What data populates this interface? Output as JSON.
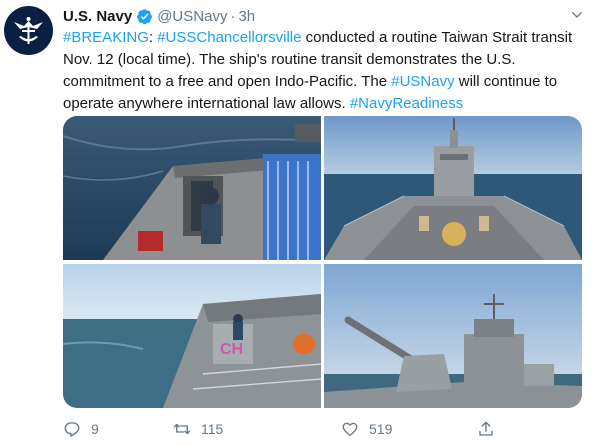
{
  "account": {
    "name": "U.S. Navy",
    "handle": "@USNavy",
    "separator": "·",
    "time": "3h"
  },
  "tweet": {
    "hashtag_breaking": "#BREAKING",
    "colon": ":",
    "mention": "#USSChancellorsville",
    "text_1": " conducted a routine Taiwan Strait transit Nov. 12 (local time). The ship's routine transit demonstrates the U.S. commitment to a free and open Indo-Pacific. The ",
    "hashtag_usnavy": "#USNavy",
    "text_2": " will continue to operate anywhere international law allows. ",
    "hashtag_readiness": "#NavyReadiness"
  },
  "actions": {
    "replies": "9",
    "retweets": "115",
    "likes": "519"
  },
  "colors": {
    "link": "#1da1f2",
    "muted": "#657786",
    "verified": "#1da1f2",
    "text": "#14171a"
  },
  "icons": {
    "avatar": "navy-emblem-icon",
    "verified": "verified-badge-icon",
    "menu": "chevron-down-icon",
    "reply": "reply-icon",
    "retweet": "retweet-icon",
    "like": "heart-icon",
    "share": "share-icon"
  }
}
